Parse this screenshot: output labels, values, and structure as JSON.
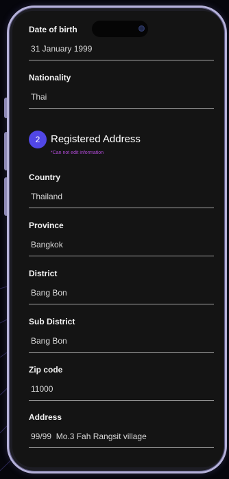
{
  "personal": {
    "dob_label": "Date of birth",
    "dob_value": "31 January 1999",
    "nationality_label": "Nationality",
    "nationality_value": "Thai"
  },
  "address_section": {
    "step_number": "2",
    "title": "Registered Address",
    "note": "*Can not edit information",
    "accent_color": "#5147e6",
    "note_color": "#b04ad6"
  },
  "address_fields": [
    {
      "label": "Country",
      "value": "Thailand"
    },
    {
      "label": "Province",
      "value": "Bangkok"
    },
    {
      "label": "District",
      "value": "Bang Bon"
    },
    {
      "label": "Sub District",
      "value": "Bang Bon"
    },
    {
      "label": "Zip code",
      "value": "11000"
    },
    {
      "label": "Address",
      "value": "99/99  Mo.3 Fah Rangsit village"
    }
  ]
}
